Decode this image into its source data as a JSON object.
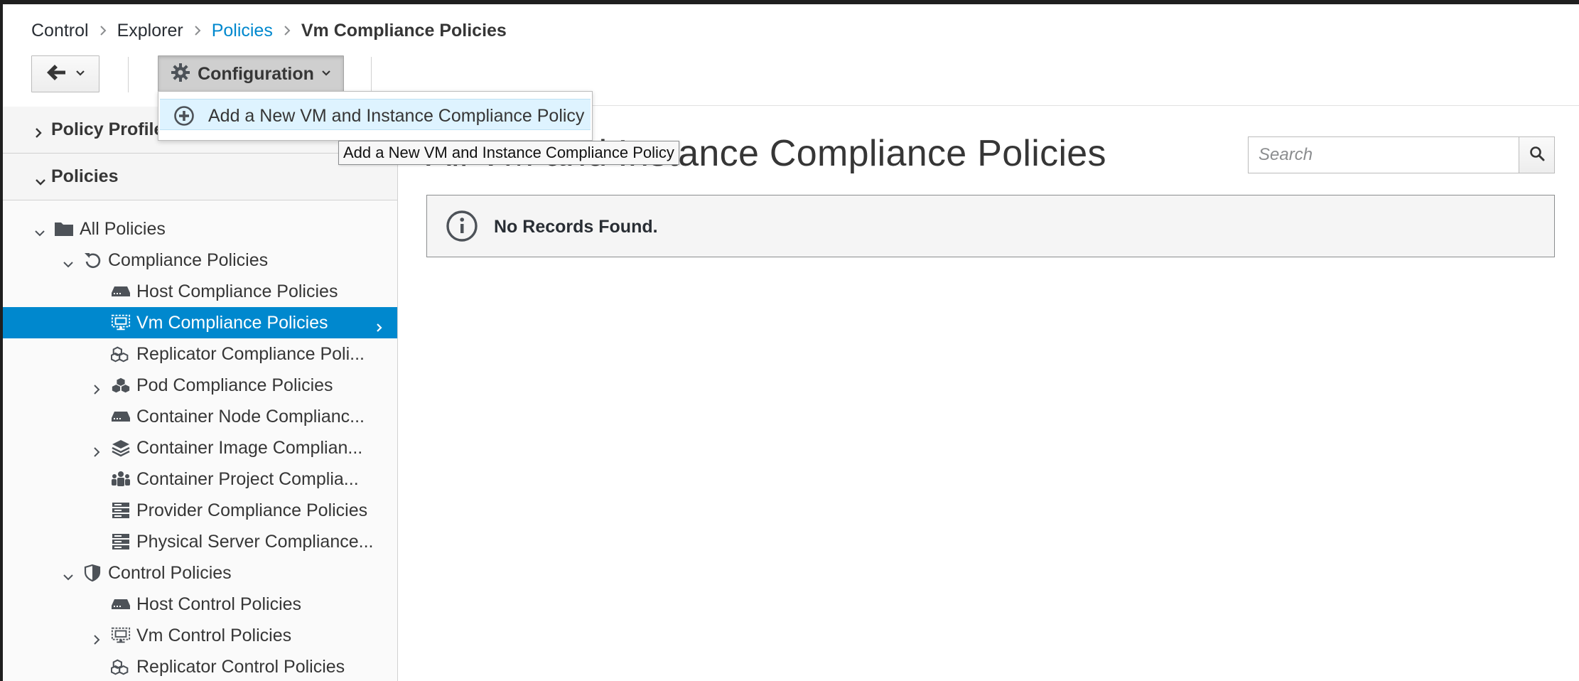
{
  "breadcrumb": {
    "items": [
      "Control",
      "Explorer",
      "Policies",
      "Vm Compliance Policies"
    ]
  },
  "toolbar": {
    "configuration_label": "Configuration"
  },
  "dropdown": {
    "items": [
      {
        "label": "Add a New VM and Instance Compliance Policy",
        "icon": "plus-circle-icon"
      }
    ]
  },
  "tooltip": {
    "text": "Add a New VM and Instance Compliance Policy"
  },
  "sidebar": {
    "accordions": [
      {
        "label": "Policy Profiles",
        "expanded": false
      },
      {
        "label": "Policies",
        "expanded": true
      }
    ],
    "tree": [
      {
        "label": "All Policies",
        "icon": "folder-icon",
        "expanded": true
      },
      {
        "label": "Compliance Policies",
        "icon": "refresh-icon",
        "expanded": true
      },
      {
        "label": "Host Compliance Policies",
        "icon": "host-icon"
      },
      {
        "label": "Vm Compliance Policies",
        "icon": "vm-icon",
        "selected": true
      },
      {
        "label": "Replicator Compliance Poli...",
        "icon": "cubes-icon"
      },
      {
        "label": "Pod Compliance Policies",
        "icon": "cubes-icon",
        "expanded": false
      },
      {
        "label": "Container Node Complianc...",
        "icon": "host-icon"
      },
      {
        "label": "Container Image Complian...",
        "icon": "layers-icon",
        "expanded": false
      },
      {
        "label": "Container Project Complia...",
        "icon": "users-icon"
      },
      {
        "label": "Provider Compliance Policies",
        "icon": "server-icon"
      },
      {
        "label": "Physical Server Compliance...",
        "icon": "server-icon"
      },
      {
        "label": "Control Policies",
        "icon": "shield-icon",
        "expanded": true
      },
      {
        "label": "Host Control Policies",
        "icon": "host-icon"
      },
      {
        "label": "Vm Control Policies",
        "icon": "vm-icon",
        "expanded": false
      },
      {
        "label": "Replicator Control Policies",
        "icon": "cubes-icon"
      }
    ]
  },
  "main": {
    "title": "All VM and Instance Compliance Policies",
    "search_placeholder": "Search",
    "alert_text": "No Records Found."
  },
  "colors": {
    "link": "#0088ce",
    "selected_bg": "#0088ce",
    "dropdown_highlight": "#def3ff",
    "text": "#363636"
  }
}
